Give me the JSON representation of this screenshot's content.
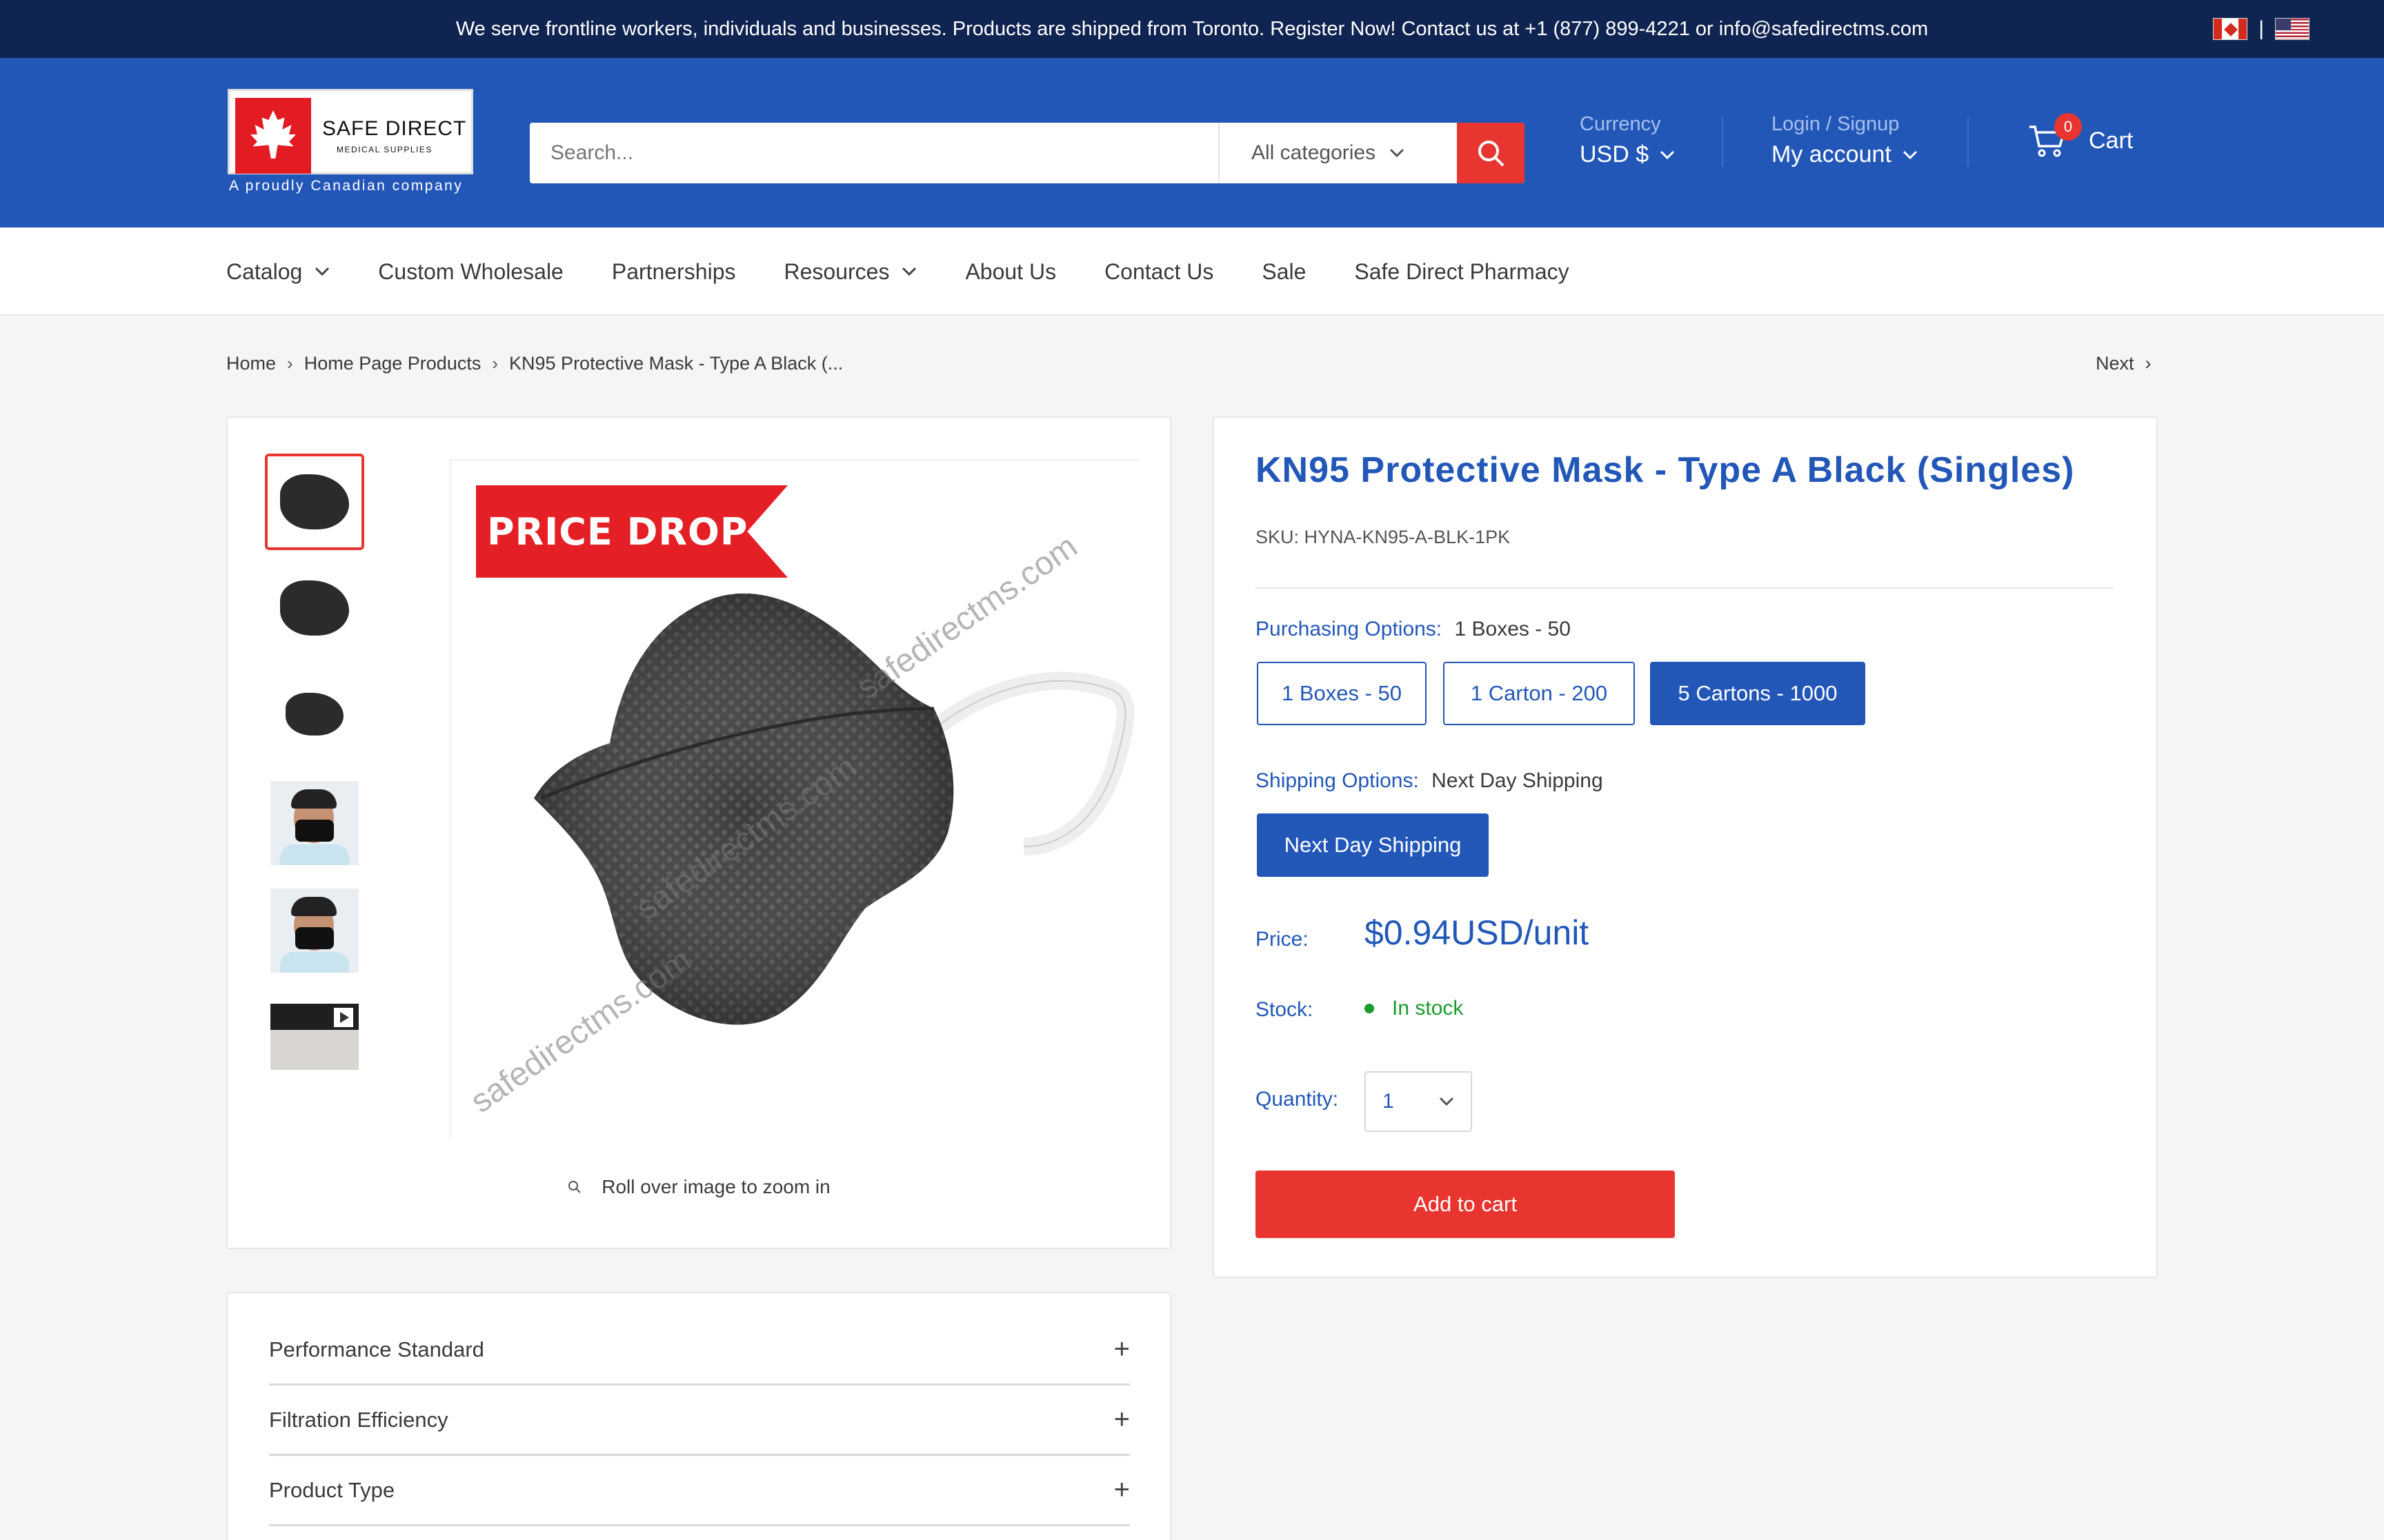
{
  "announcement": {
    "text": "We serve frontline workers, individuals and businesses. Products are shipped from Toronto. Register Now! Contact us at +1 (877) 899-4221 or info@safedirectms.com",
    "flag_separator": "|"
  },
  "logo": {
    "brand": "SAFE DIRECT",
    "brand_sub": "MEDICAL SUPPLIES",
    "tagline": "A proudly Canadian company"
  },
  "search": {
    "placeholder": "Search...",
    "category": "All categories"
  },
  "currency": {
    "label": "Currency",
    "value": "USD $"
  },
  "account": {
    "label": "Login / Signup",
    "value": "My account"
  },
  "cart": {
    "label": "Cart",
    "count": "0"
  },
  "nav": {
    "items": [
      {
        "label": "Catalog",
        "has_dropdown": true
      },
      {
        "label": "Custom Wholesale",
        "has_dropdown": false
      },
      {
        "label": "Partnerships",
        "has_dropdown": false
      },
      {
        "label": "Resources",
        "has_dropdown": true
      },
      {
        "label": "About Us",
        "has_dropdown": false
      },
      {
        "label": "Contact Us",
        "has_dropdown": false
      },
      {
        "label": "Sale",
        "has_dropdown": false
      },
      {
        "label": "Safe Direct Pharmacy",
        "has_dropdown": false
      }
    ]
  },
  "breadcrumb": {
    "items": [
      "Home",
      "Home Page Products",
      "KN95 Protective Mask - Type A Black (..."
    ],
    "next": "Next"
  },
  "gallery": {
    "badge": "PRICE DROP",
    "watermark": "safedirectms.com",
    "zoom_hint": "Roll over image to zoom in"
  },
  "product": {
    "title": "KN95 Protective Mask - Type A Black (Singles)",
    "sku": "SKU: HYNA-KN95-A-BLK-1PK",
    "purchasing_label": "Purchasing Options:",
    "purchasing_selected": "1 Boxes - 50",
    "purchasing_options": [
      "1 Boxes - 50",
      "1 Carton - 200",
      "5 Cartons - 1000"
    ],
    "shipping_label": "Shipping Options:",
    "shipping_selected": "Next Day Shipping",
    "shipping_options": [
      "Next Day Shipping"
    ],
    "price_label": "Price:",
    "price": "$0.94USD/unit",
    "stock_label": "Stock:",
    "stock": "In stock",
    "quantity_label": "Quantity:",
    "quantity": "1",
    "add_to_cart": "Add to cart"
  },
  "accordion": {
    "items": [
      "Performance Standard",
      "Filtration Efficiency",
      "Product Type"
    ]
  },
  "colors": {
    "primary": "#2257b8",
    "topbar": "#0f2451",
    "accent_red": "#e8352f",
    "in_stock": "#1a9b2e"
  }
}
